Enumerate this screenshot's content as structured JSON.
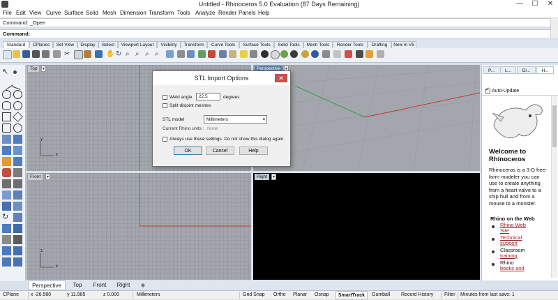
{
  "window": {
    "title": "Untitled - Rhinoceros 5.0 Evaluation (87 Days Remaining)",
    "minimize_label": "—",
    "maximize_label": "☐",
    "close_label": "✕"
  },
  "menu": [
    "File",
    "Edit",
    "View",
    "Curve",
    "Surface",
    "Solid",
    "Mesh",
    "Dimension",
    "Transform",
    "Tools",
    "Analyze",
    "Render",
    "Panels",
    "Help"
  ],
  "command": {
    "history": "Command: _Open",
    "prompt_label": "Command:"
  },
  "toolbar_tabs": [
    "Standard",
    "CPlanes",
    "Set View",
    "Display",
    "Select",
    "Viewport Layout",
    "Visibility",
    "Transform",
    "Curve Tools",
    "Surface Tools",
    "Solid Tools",
    "Mesh Tools",
    "Render Tools",
    "Drafting",
    "New in V5"
  ],
  "viewports": {
    "top": "Top",
    "perspective": "Perspective",
    "front": "Front",
    "right": "Right",
    "axis_x": "x",
    "axis_y": "y",
    "axis_z": "z"
  },
  "viewport_tabs": [
    "Perspective",
    "Top",
    "Front",
    "Right"
  ],
  "dialog": {
    "title": "STL Import Options",
    "weld_angle_label": "Weld angle",
    "weld_angle_value": "22.5",
    "degrees_label": "degrees",
    "split_label": "Split disjoint meshes",
    "stl_model_label": "STL model",
    "stl_model_value": "Millimeters",
    "current_units_label": "Current Rhino units :",
    "current_units_value": "None",
    "always_use_label": "Always use these settings. Do not show this dialog again.",
    "ok": "OK",
    "cancel": "Cancel",
    "help": "Help"
  },
  "right_panel": {
    "tabs": [
      "P...",
      "L...",
      "Di...",
      "H..."
    ],
    "auto_update": "Auto-Update",
    "welcome_title": "Welcome to Rhinoceros",
    "intro": "Rhinoceros is a 3-D free-form modeler you can use to create anything from a heart valve to a ship hull and from a mouse to a monster.",
    "web_heading": "Rhino on the Web",
    "links": [
      {
        "line1": "Rhino Web",
        "line2": "Site",
        "link": true
      },
      {
        "line1": "Technical",
        "line2": "support",
        "link": true
      },
      {
        "line1": "Classroom",
        "line2": "training",
        "link": true
      },
      {
        "line1": "Rhino",
        "line2": "books and",
        "link": true
      }
    ]
  },
  "status": {
    "cplane": "CPlane",
    "x": "x -26.580",
    "y": "y 11.985",
    "z": "z 0.000",
    "units": "Millimeters",
    "grid_snap": "Grid Snap",
    "ortho": "Ortho",
    "planar": "Planar",
    "osnap": "Osnap",
    "smarttrack": "SmartTrack",
    "gumball": "Gumball",
    "record_history": "Record History",
    "filter": "Filter",
    "last_save": "Minutes from last save: 1"
  },
  "colors": {
    "viewport_bg": "#a3a7ad",
    "right_bg": "#000000",
    "x_axis": "#c0392b",
    "y_axis": "#2e9e3b",
    "accent": "#5a7fa8"
  }
}
